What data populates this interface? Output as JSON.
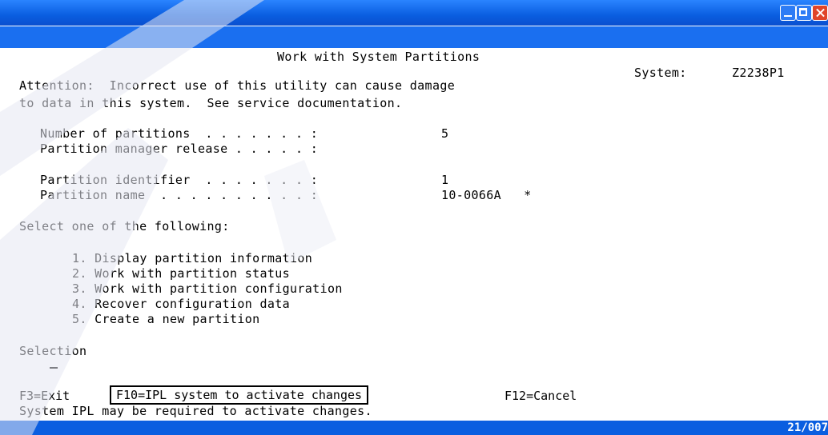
{
  "screen": {
    "title": "Work with System Partitions",
    "system_label": "System:",
    "system_name": "Z2238P1",
    "attention_line1": "Attention:  Incorrect use of this utility can cause damage",
    "attention_line2": "to data in this system.  See service documentation.",
    "fields": [
      {
        "label": "Number of partitions  . . . . . . . :",
        "value": "5"
      },
      {
        "label": "Partition manager release . . . . . :",
        "value": ""
      },
      {
        "label": "Partition identifier  . . . . . . . :",
        "value": "1"
      },
      {
        "label": "Partition name  . . . . . . . . . . :",
        "value": "10-0066A   *"
      }
    ],
    "select_prompt": "Select one of the following:",
    "options": [
      "1. Display partition information",
      "2. Work with partition status",
      "3. Work with partition configuration",
      "4. Recover configuration data",
      "5. Create a new partition"
    ],
    "selection_label": "Selection",
    "selection_value": "",
    "function_keys": {
      "f3": "F3=Exit",
      "f10": "F10=IPL system to activate changes",
      "f12": "F12=Cancel"
    },
    "message": "System IPL may be required to activate changes."
  },
  "status": {
    "cursor_position": "21/007"
  },
  "colors": {
    "titlebar": "#0a5ee0",
    "close_button": "#e0452a",
    "background": "#ffffff",
    "text": "#000000"
  }
}
